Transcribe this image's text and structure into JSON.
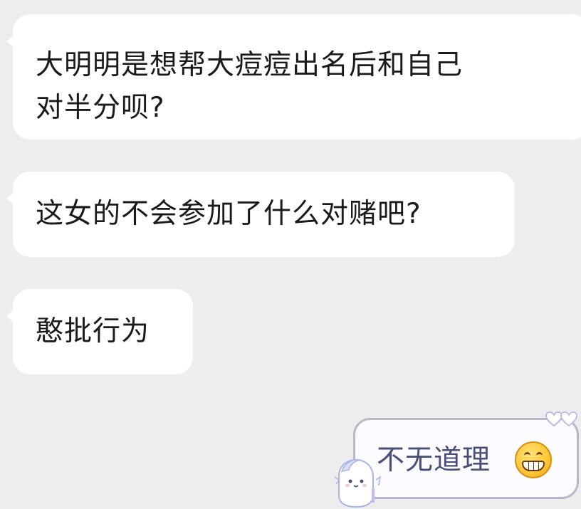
{
  "messages": [
    {
      "text_line1": "大明明是想帮大痘痘出名后和自己",
      "text_line2": "对半分呗?"
    },
    {
      "text": "这女的不会参加了什么对赌吧?"
    },
    {
      "text": "憨批行为"
    }
  ],
  "outgoing": {
    "text": "不无道理",
    "emoji": "grinning-face-icon"
  },
  "colors": {
    "background": "#ededed",
    "incoming_bubble": "#ffffff",
    "outgoing_border": "#b8b8c8",
    "outgoing_text": "#4a4f78"
  }
}
